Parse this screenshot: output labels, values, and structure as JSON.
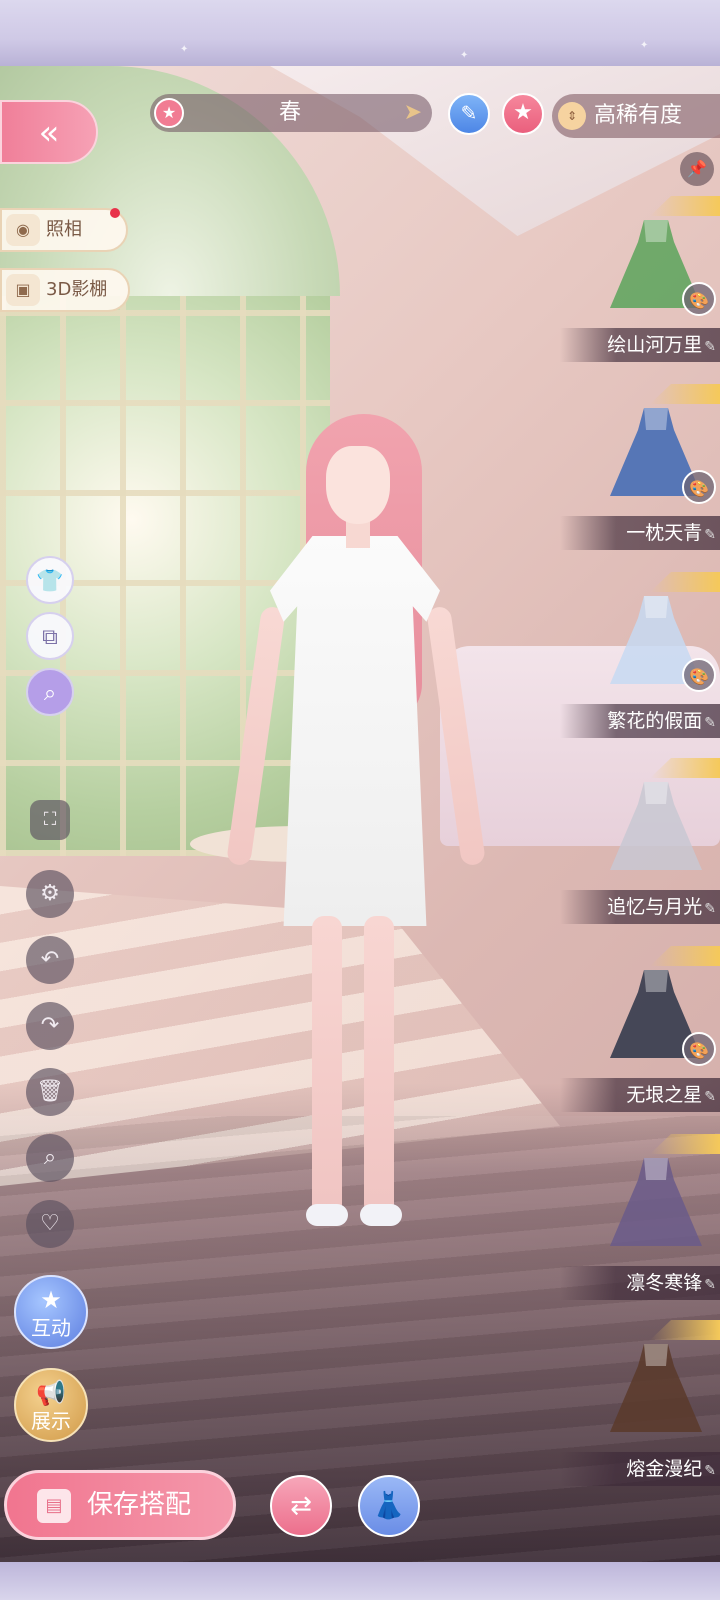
{
  "top_bar": {
    "back_icon": "double-chevron-left-icon",
    "season": "春",
    "season_icon": "star-icon",
    "next_icon": "arrow-right-icon",
    "pen_icon": "pen-icon",
    "favorite_icon": "star-icon",
    "rank_label": "高稀有度",
    "rank_icon": "sort-icon",
    "pin_icon": "pin-icon"
  },
  "left_menu": {
    "photo_label": "照相",
    "photo_icon": "camera-icon",
    "studio_label": "3D影棚",
    "studio_icon": "cube-icon",
    "has_notification": true
  },
  "tools": [
    {
      "name": "wardrobe-tool",
      "icon": "shirt-icon"
    },
    {
      "name": "copy-tool",
      "icon": "copy-icon"
    },
    {
      "name": "search-magic-tool",
      "icon": "magnify-sparkle-icon"
    },
    {
      "name": "fullscreen-tool",
      "icon": "fullscreen-icon"
    },
    {
      "name": "settings-tool",
      "icon": "gear-icon"
    },
    {
      "name": "undo-tool",
      "icon": "undo-icon"
    },
    {
      "name": "redo-tool",
      "icon": "redo-icon"
    },
    {
      "name": "delete-tool",
      "icon": "trash-icon"
    },
    {
      "name": "search-tool",
      "icon": "search-icon"
    },
    {
      "name": "favorite-tool",
      "icon": "heart-icon"
    }
  ],
  "actions": {
    "interact_label": "互动",
    "display_label": "展示",
    "save_label": "保存搭配",
    "swap_icon": "swap-icon",
    "outfit_icon": "outfit-icon"
  },
  "outfits": [
    {
      "name": "绘山河万里",
      "color": "#5aa35a"
    },
    {
      "name": "一枕天青",
      "color": "#3d68b5"
    },
    {
      "name": "繁花的假面",
      "color": "#c7d9f2"
    },
    {
      "name": "追忆与月光",
      "color": "#c8c8d2"
    },
    {
      "name": "无垠之星",
      "color": "#2c3448"
    },
    {
      "name": "凛冬寒锋",
      "color": "#6a5a8a"
    },
    {
      "name": "熔金漫纪",
      "color": "#5a3a2a"
    }
  ],
  "colors": {
    "accent_pink": "#f1758f",
    "accent_blue": "#6a8de6",
    "gold": "#f5c95a"
  }
}
